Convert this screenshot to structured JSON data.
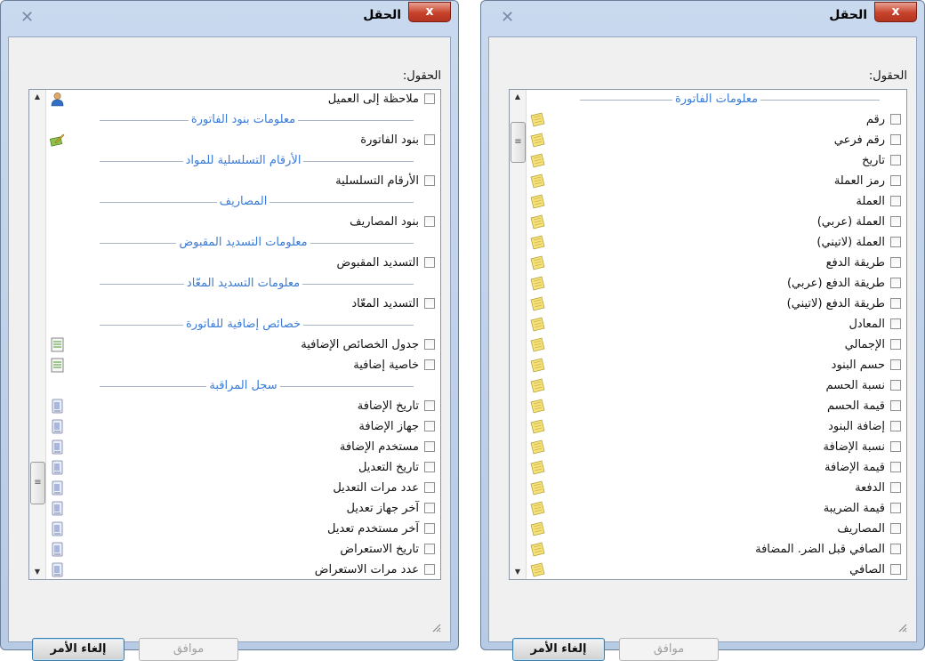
{
  "dialogs": [
    {
      "title": "الحقل",
      "close_label": "x",
      "fields_label": "الحقول:",
      "buttons": {
        "cancel": "إلغاء الأمر",
        "ok": "موافق"
      },
      "items": [
        {
          "type": "field",
          "label": "ملاحظة إلى العميل",
          "icon": "user-icon"
        },
        {
          "type": "group",
          "label": "معلومات بنود الفاتورة"
        },
        {
          "type": "field",
          "label": "بنود الفاتورة",
          "icon": "edit-book-icon"
        },
        {
          "type": "group",
          "label": "الأرقام التسلسلية للمواد"
        },
        {
          "type": "field",
          "label": "الأرقام التسلسلية",
          "icon": ""
        },
        {
          "type": "group",
          "label": "المصاريف"
        },
        {
          "type": "field",
          "label": "بنود المصاريف",
          "icon": ""
        },
        {
          "type": "group",
          "label": "معلومات التسديد المقبوض"
        },
        {
          "type": "field",
          "label": "التسديد المقبوض",
          "icon": ""
        },
        {
          "type": "group",
          "label": "معلومات التسديد المعّاد"
        },
        {
          "type": "field",
          "label": "التسديد المعّاد",
          "icon": ""
        },
        {
          "type": "group",
          "label": "خصائص إضافية للفاتورة"
        },
        {
          "type": "field",
          "label": "جدول الخصائص الإضافية",
          "icon": "table-icon"
        },
        {
          "type": "field",
          "label": "خاصية إضافية",
          "icon": "table-icon"
        },
        {
          "type": "group",
          "label": "سجل المراقبة"
        },
        {
          "type": "field",
          "label": "تاريخ الإضافة",
          "icon": "log-icon"
        },
        {
          "type": "field",
          "label": "جهاز الإضافة",
          "icon": "log-icon"
        },
        {
          "type": "field",
          "label": "مستخدم الإضافة",
          "icon": "log-icon"
        },
        {
          "type": "field",
          "label": "تاريخ التعديل",
          "icon": "log-icon"
        },
        {
          "type": "field",
          "label": "عدد مرات التعديل",
          "icon": "log-icon"
        },
        {
          "type": "field",
          "label": "آخر جهاز تعديل",
          "icon": "log-icon"
        },
        {
          "type": "field",
          "label": "آخر مستخدم تعديل",
          "icon": "log-icon"
        },
        {
          "type": "field",
          "label": "تاريخ الاستعراض",
          "icon": "log-icon"
        },
        {
          "type": "field",
          "label": "عدد مرات الاستعراض",
          "icon": "log-icon"
        }
      ]
    },
    {
      "title": "الحقل",
      "close_label": "x",
      "fields_label": "الحقول:",
      "buttons": {
        "cancel": "إلغاء الأمر",
        "ok": "موافق"
      },
      "items": [
        {
          "type": "group",
          "label": "معلومات الفاتورة"
        },
        {
          "type": "field",
          "label": "رقم",
          "icon": "note-icon"
        },
        {
          "type": "field",
          "label": "رقم فرعي",
          "icon": "note-icon"
        },
        {
          "type": "field",
          "label": "تاريخ",
          "icon": "note-icon"
        },
        {
          "type": "field",
          "label": "رمز العملة",
          "icon": "note-icon"
        },
        {
          "type": "field",
          "label": "العملة",
          "icon": "note-icon"
        },
        {
          "type": "field",
          "label": "العملة (عربي)",
          "icon": "note-icon"
        },
        {
          "type": "field",
          "label": "العملة (لاتيني)",
          "icon": "note-icon"
        },
        {
          "type": "field",
          "label": "طريقة الدفع",
          "icon": "note-icon"
        },
        {
          "type": "field",
          "label": "طريقة الدفع (عربي)",
          "icon": "note-icon"
        },
        {
          "type": "field",
          "label": "طريقة الدفع (لاتيني)",
          "icon": "note-icon"
        },
        {
          "type": "field",
          "label": "المعادل",
          "icon": "note-icon"
        },
        {
          "type": "field",
          "label": "الإجمالي",
          "icon": "note-icon"
        },
        {
          "type": "field",
          "label": "حسم البنود",
          "icon": "note-icon"
        },
        {
          "type": "field",
          "label": "نسبة الحسم",
          "icon": "note-icon"
        },
        {
          "type": "field",
          "label": "قيمة الحسم",
          "icon": "note-icon"
        },
        {
          "type": "field",
          "label": "إضافة البنود",
          "icon": "note-icon"
        },
        {
          "type": "field",
          "label": "نسبة الإضافة",
          "icon": "note-icon"
        },
        {
          "type": "field",
          "label": "قيمة الإضافة",
          "icon": "note-icon"
        },
        {
          "type": "field",
          "label": "الدفعة",
          "icon": "note-icon"
        },
        {
          "type": "field",
          "label": "قيمة الضريبة",
          "icon": "note-icon"
        },
        {
          "type": "field",
          "label": "المصاريف",
          "icon": "note-icon"
        },
        {
          "type": "field",
          "label": "الصافي قبل الضر. المضافة",
          "icon": "note-icon"
        },
        {
          "type": "field",
          "label": "الصافي",
          "icon": "note-icon"
        }
      ]
    }
  ]
}
